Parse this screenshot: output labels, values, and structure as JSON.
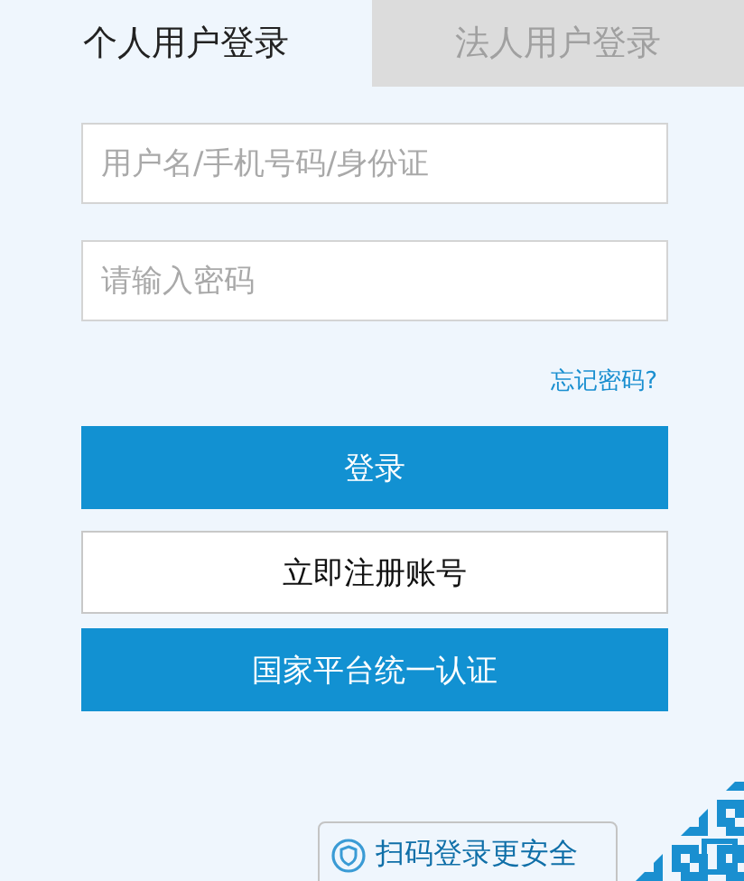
{
  "tabs": [
    {
      "label": "个人用户登录",
      "selected": true
    },
    {
      "label": "法人用户登录",
      "selected": false
    }
  ],
  "fields": [
    {
      "placeholder": "用户名/手机号码/身份证"
    },
    {
      "placeholder": "请输入密码"
    }
  ],
  "forgot_link": "忘记密码?",
  "buttons": [
    {
      "label": "登录",
      "kind": "primary"
    },
    {
      "label": "立即注册账号",
      "kind": "secondary"
    },
    {
      "label": "国家平台统一认证",
      "kind": "primary"
    }
  ],
  "scan_tip": "扫码登录更安全"
}
